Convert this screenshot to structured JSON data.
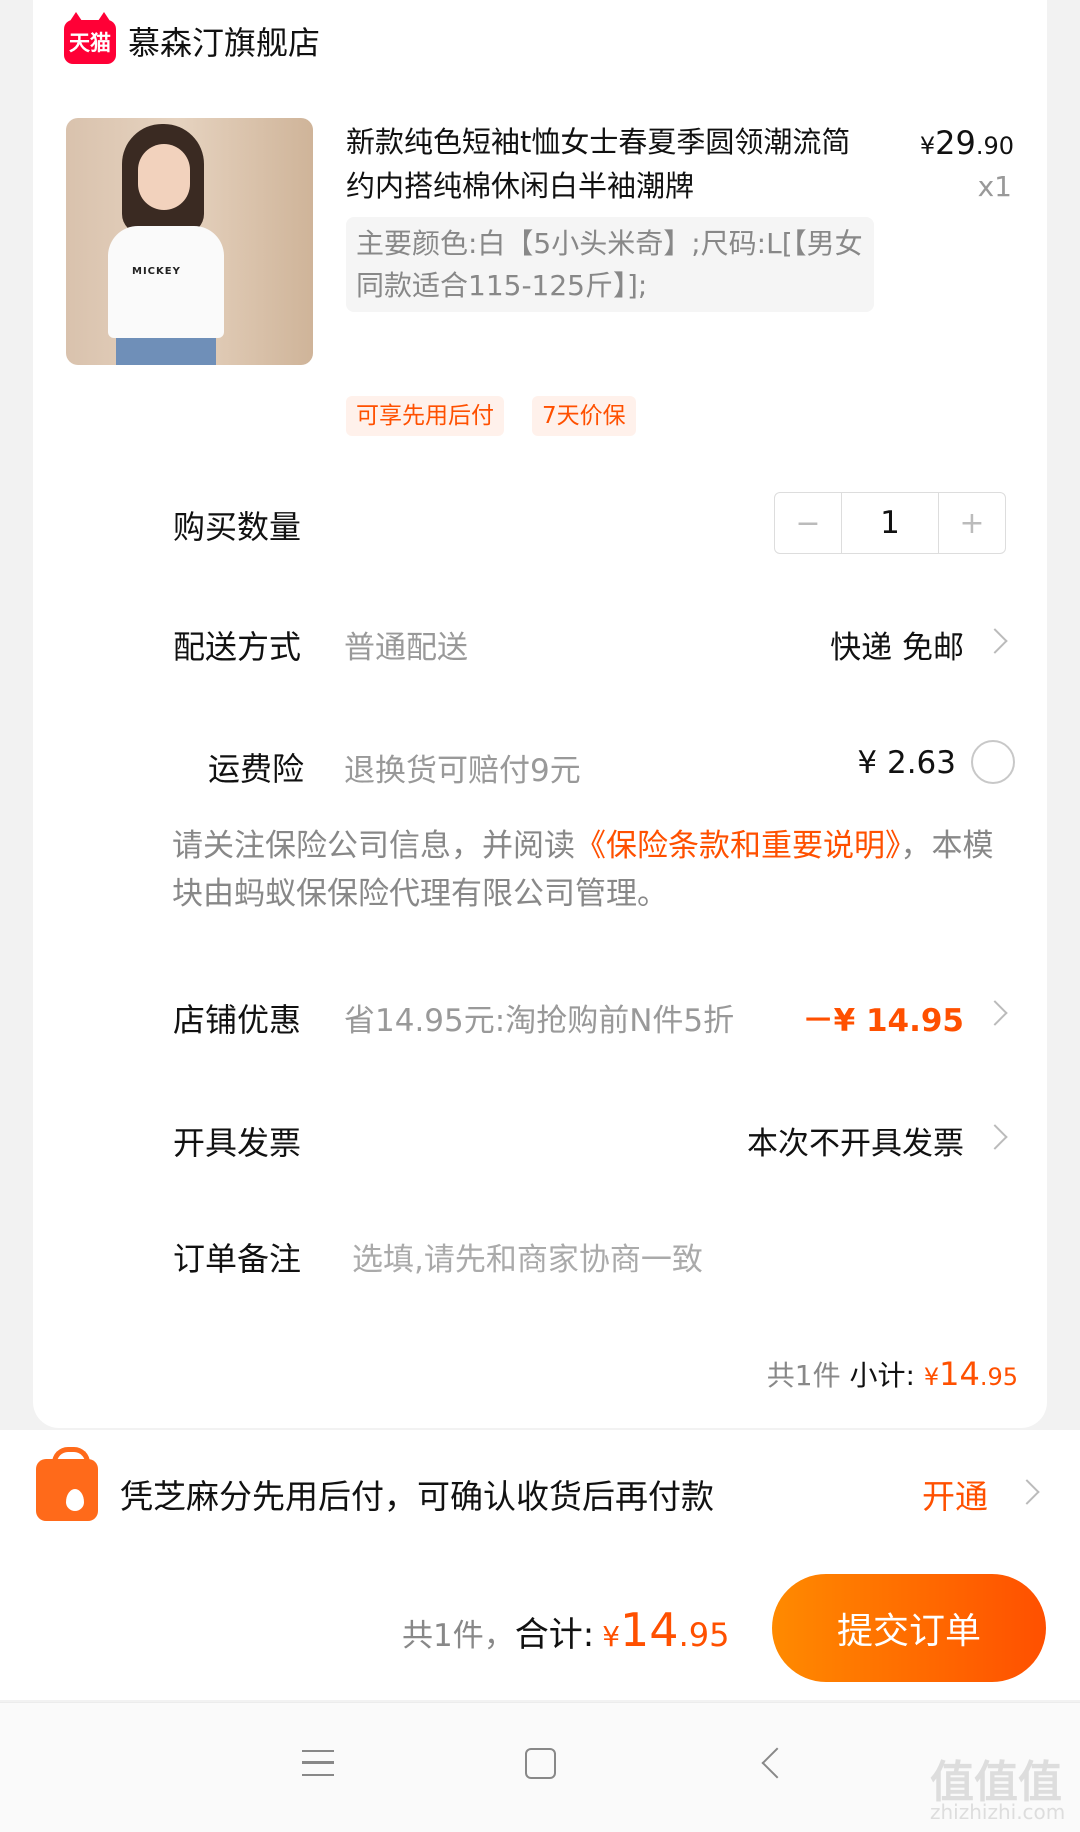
{
  "store": {
    "logo_text": "天猫",
    "name": "慕森汀旗舰店"
  },
  "product": {
    "image_label": "MICKEY",
    "title": "新款纯色短袖t恤女士春夏季圆领潮流简约内搭纯棉休闲白半袖潮牌",
    "price_currency": "¥",
    "price_int": "29",
    "price_dec": ".90",
    "quantity": "x1",
    "sku": "主要颜色:白【5小头米奇】;尺码:L[【男女同款适合115-125斤】];",
    "tags": [
      "可享先用后付",
      "7天价保"
    ]
  },
  "order": {
    "qty_label": "购买数量",
    "qty_minus": "−",
    "qty_value": "1",
    "qty_plus": "+",
    "delivery_label": "配送方式",
    "delivery_value": "普通配送",
    "delivery_right": "快递 免邮",
    "insurance_label": "运费险",
    "insurance_value": "退换货可赔付9元",
    "insurance_price": "¥ 2.63",
    "notice_prefix": "请关注保险公司信息，并阅读",
    "notice_link": "《保险条款和重要说明》",
    "notice_suffix": "，本模块由蚂蚁保保险代理有限公司管理。",
    "discount_label": "店铺优惠",
    "discount_value": "省14.95元:淘抢购前N件5折",
    "discount_amount": "－¥ 14.95",
    "invoice_label": "开具发票",
    "invoice_value": "本次不开具发票",
    "remark_label": "订单备注",
    "remark_placeholder": "选填,请先和商家协商一致",
    "count": "共1件",
    "subtotal_label": "小计:",
    "subtotal_currency": "¥",
    "subtotal_int": "14",
    "subtotal_dec": ".95"
  },
  "payment": {
    "promo_text": "凭芝麻分先用后付，可确认收货后再付款",
    "promo_action": "开通",
    "total_count": "共1件，",
    "total_label": "合计:",
    "total_currency": "¥",
    "total_int": "14",
    "total_dec": ".95",
    "submit_label": "提交订单"
  },
  "watermark": {
    "main": "值值值",
    "sub": "zhizhizhi.com"
  },
  "colors": {
    "accent": "#ff5000",
    "tmall": "#ff0036"
  }
}
